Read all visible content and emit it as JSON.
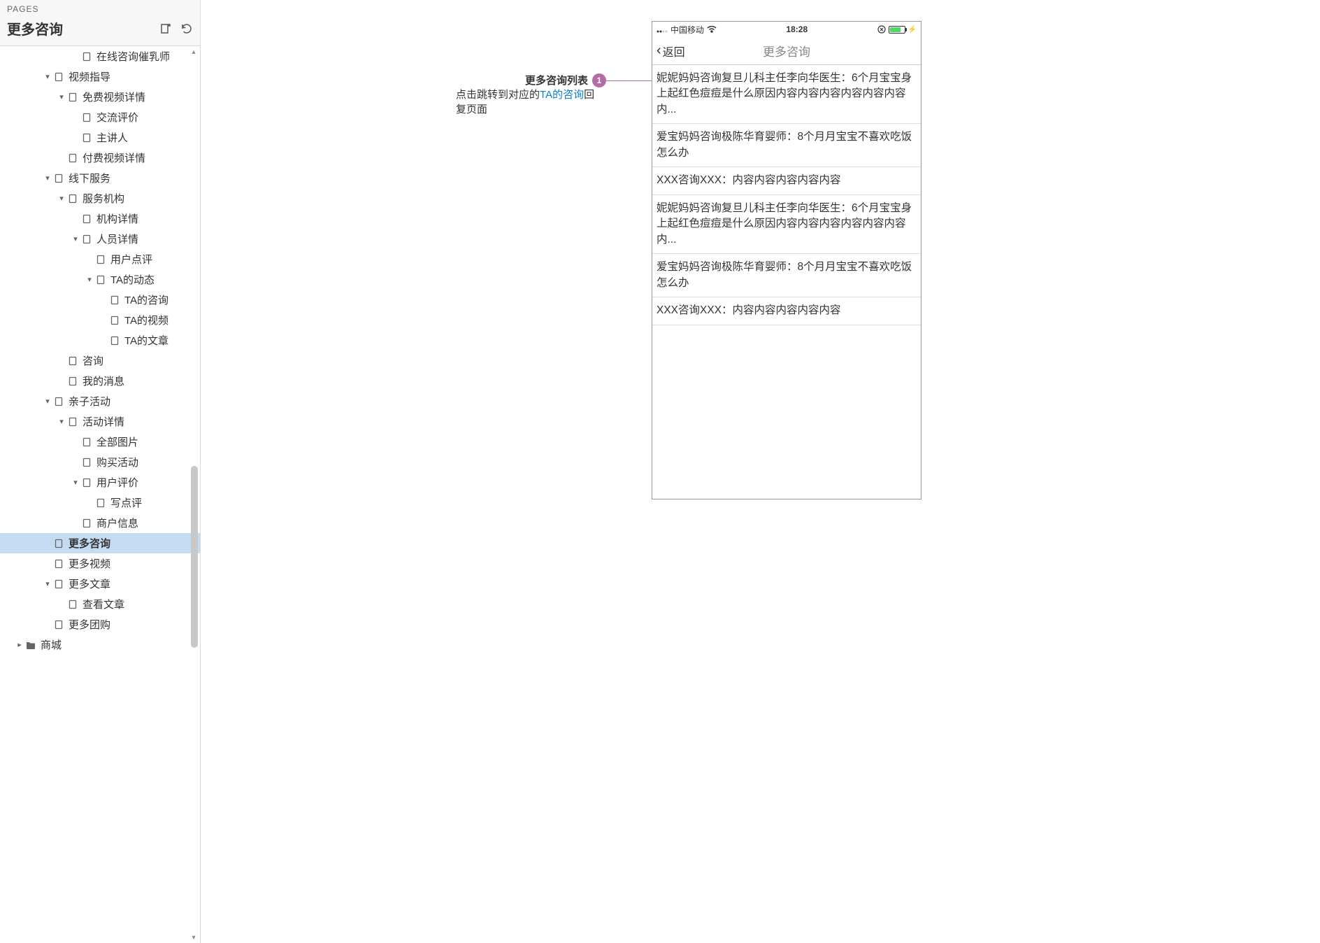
{
  "sidebar": {
    "panel_label": "PAGES",
    "title": "更多咨询",
    "tree": [
      {
        "indent": 5,
        "toggle": "",
        "icon": "page",
        "label": "在线咨询催乳师"
      },
      {
        "indent": 3,
        "toggle": "down",
        "icon": "page",
        "label": "视频指导"
      },
      {
        "indent": 4,
        "toggle": "down",
        "icon": "page",
        "label": "免费视频详情"
      },
      {
        "indent": 5,
        "toggle": "",
        "icon": "page",
        "label": "交流评价"
      },
      {
        "indent": 5,
        "toggle": "",
        "icon": "page",
        "label": "主讲人"
      },
      {
        "indent": 4,
        "toggle": "",
        "icon": "page",
        "label": "付费视频详情"
      },
      {
        "indent": 3,
        "toggle": "down",
        "icon": "page",
        "label": "线下服务"
      },
      {
        "indent": 4,
        "toggle": "down",
        "icon": "page",
        "label": "服务机构"
      },
      {
        "indent": 5,
        "toggle": "",
        "icon": "page",
        "label": "机构详情"
      },
      {
        "indent": 5,
        "toggle": "down",
        "icon": "page",
        "label": "人员详情"
      },
      {
        "indent": 6,
        "toggle": "",
        "icon": "page",
        "label": "用户点评"
      },
      {
        "indent": 6,
        "toggle": "down",
        "icon": "page",
        "label": "TA的动态"
      },
      {
        "indent": 7,
        "toggle": "",
        "icon": "page",
        "label": "TA的咨询"
      },
      {
        "indent": 7,
        "toggle": "",
        "icon": "page",
        "label": "TA的视频"
      },
      {
        "indent": 7,
        "toggle": "",
        "icon": "page",
        "label": "TA的文章"
      },
      {
        "indent": 4,
        "toggle": "",
        "icon": "page",
        "label": "咨询"
      },
      {
        "indent": 4,
        "toggle": "",
        "icon": "page",
        "label": "我的消息"
      },
      {
        "indent": 3,
        "toggle": "down",
        "icon": "page",
        "label": "亲子活动"
      },
      {
        "indent": 4,
        "toggle": "down",
        "icon": "page",
        "label": "活动详情"
      },
      {
        "indent": 5,
        "toggle": "",
        "icon": "page",
        "label": "全部图片"
      },
      {
        "indent": 5,
        "toggle": "",
        "icon": "page",
        "label": "购买活动"
      },
      {
        "indent": 5,
        "toggle": "down",
        "icon": "page",
        "label": "用户评价"
      },
      {
        "indent": 6,
        "toggle": "",
        "icon": "page",
        "label": "写点评"
      },
      {
        "indent": 5,
        "toggle": "",
        "icon": "page",
        "label": "商户信息"
      },
      {
        "indent": 3,
        "toggle": "",
        "icon": "page",
        "label": "更多咨询",
        "selected": true
      },
      {
        "indent": 3,
        "toggle": "",
        "icon": "page",
        "label": "更多视频"
      },
      {
        "indent": 3,
        "toggle": "down",
        "icon": "page",
        "label": "更多文章"
      },
      {
        "indent": 4,
        "toggle": "",
        "icon": "page",
        "label": "查看文章"
      },
      {
        "indent": 3,
        "toggle": "",
        "icon": "page",
        "label": "更多团购"
      },
      {
        "indent": 1,
        "toggle": "right",
        "icon": "folder",
        "label": "商城"
      }
    ]
  },
  "annotation": {
    "title": "更多咨询列表",
    "marker": "1",
    "desc_prefix": "点击跳转到对应的",
    "desc_link": "TA的咨询",
    "desc_suffix": "回复页面"
  },
  "phone": {
    "carrier": "中国移动",
    "time": "18:28",
    "back_label": "返回",
    "nav_title": "更多咨询",
    "items": [
      "妮妮妈妈咨询复旦儿科主任李向华医生：6个月宝宝身上起红色痘痘是什么原因内容内容内容内容内容内容内...",
      "爱宝妈妈咨询极陈华育婴师：8个月月宝宝不喜欢吃饭怎么办",
      "XXX咨询XXX：内容内容内容内容内容",
      "妮妮妈妈咨询复旦儿科主任李向华医生：6个月宝宝身上起红色痘痘是什么原因内容内容内容内容内容内容内...",
      "爱宝妈妈咨询极陈华育婴师：8个月月宝宝不喜欢吃饭怎么办",
      "XXX咨询XXX：内容内容内容内容内容"
    ]
  }
}
